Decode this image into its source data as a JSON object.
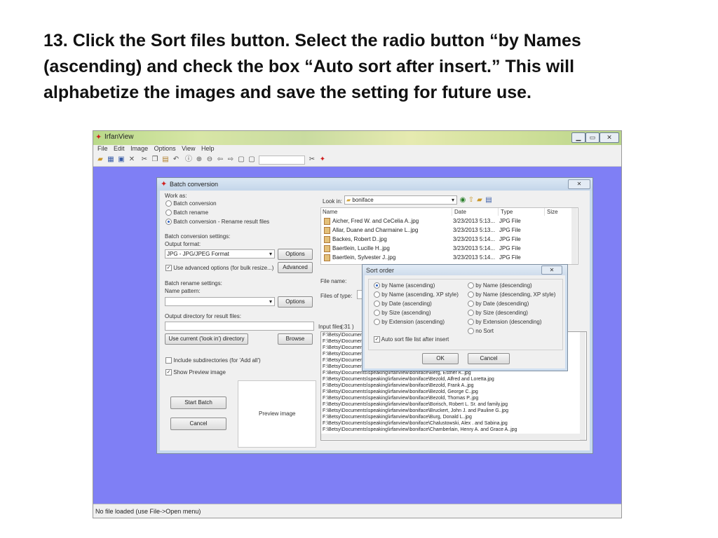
{
  "slide": {
    "title": "13. Click the Sort files button.  Select the radio button “by Names (ascending) and check the box “Auto sort after insert.”  This will alphabetize the images and save the setting for future use."
  },
  "app": {
    "title": "IrfanView",
    "menu": [
      "File",
      "Edit",
      "Image",
      "Options",
      "View",
      "Help"
    ],
    "status": "No file loaded (use File->Open menu)"
  },
  "batch": {
    "title": "Batch conversion",
    "work_as_label": "Work as:",
    "work_as": [
      "Batch conversion",
      "Batch rename",
      "Batch conversion - Rename result files"
    ],
    "conv_settings_label": "Batch conversion settings:",
    "output_format_label": "Output format:",
    "output_format_value": "JPG - JPG/JPEG Format",
    "options_label": "Options",
    "advanced_cb_label": "Use advanced options (for bulk resize...)",
    "advanced_label": "Advanced",
    "rename_settings_label": "Batch rename settings:",
    "name_pattern_label": "Name pattern:",
    "output_dir_label": "Output directory for result files:",
    "use_current_label": "Use current ('look in') directory",
    "browse_label": "Browse",
    "include_subdirs_label": "Include subdirectories (for 'Add all')",
    "show_preview_label": "Show Preview image",
    "start_label": "Start Batch",
    "cancel_label": "Cancel",
    "preview_label": "Preview image",
    "look_in_label": "Look in:",
    "look_in_value": "boniface",
    "columns": [
      "Name",
      "Date",
      "Type",
      "Size"
    ],
    "files": [
      {
        "name": "Aicher, Fred W. and CeCelia A..jpg",
        "date": "3/23/2013 5:13...",
        "type": "JPG File"
      },
      {
        "name": "Allar, Duane and Charmaine L..jpg",
        "date": "3/23/2013 5:13...",
        "type": "JPG File"
      },
      {
        "name": "Backes, Robert D..jpg",
        "date": "3/23/2013 5:14...",
        "type": "JPG File"
      },
      {
        "name": "Baertlein, Lucille H..jpg",
        "date": "3/23/2013 5:14...",
        "type": "JPG File"
      },
      {
        "name": "Baertlein, Sylvester J..jpg",
        "date": "3/23/2013 5:14...",
        "type": "JPG File"
      }
    ],
    "file_name_label": "File name:",
    "files_of_type_label": "Files of type:",
    "input_files_label": "Input files:",
    "input_files_count": "( 31 )",
    "input_paths": [
      "F:\\Betsy\\Documents",
      "F:\\Betsy\\Documents",
      "F:\\Betsy\\Documents",
      "F:\\Betsy\\Documents",
      "F:\\Betsy\\Documents",
      "F:\\Betsy\\Documents\\speaking\\irfanview\\boniface\\Barbien, Todd R..jpg",
      "F:\\Betsy\\Documents\\speaking\\irfanview\\boniface\\Berg, Esther K..jpg",
      "F:\\Betsy\\Documents\\speaking\\irfanview\\boniface\\Bezold, Alfred and Loretta.jpg",
      "F:\\Betsy\\Documents\\speaking\\irfanview\\boniface\\Bezold, Frank A..jpg",
      "F:\\Betsy\\Documents\\speaking\\irfanview\\boniface\\Bezold, George C..jpg",
      "F:\\Betsy\\Documents\\speaking\\irfanview\\boniface\\Bezold, Thomas P..jpg",
      "F:\\Betsy\\Documents\\speaking\\irfanview\\boniface\\Borisch, Robert L. Sr. and family.jpg",
      "F:\\Betsy\\Documents\\speaking\\irfanview\\boniface\\Bruckert, John J. and Pauline G..jpg",
      "F:\\Betsy\\Documents\\speaking\\irfanview\\boniface\\Burg, Donald L..jpg",
      "F:\\Betsy\\Documents\\speaking\\irfanview\\boniface\\Chalustowski, Alex . and Sabina.jpg",
      "F:\\Betsy\\Documents\\speaking\\irfanview\\boniface\\Chamberlain, Henry A. and Grace A..jpg"
    ]
  },
  "sort": {
    "title": "Sort order",
    "left_options": [
      "by Name (ascending)",
      "by Name (ascending, XP style)",
      "by Date (ascending)",
      "by Size (ascending)",
      "by Extension (ascending)"
    ],
    "right_options": [
      "by Name (descending)",
      "by Name (descending, XP style)",
      "by Date (descending)",
      "by Size (descending)",
      "by Extension (descending)",
      "no Sort"
    ],
    "auto_sort_label": "Auto sort file list after insert",
    "ok_label": "OK",
    "cancel_label": "Cancel"
  },
  "colors": {
    "workspace": "#7f7ff5",
    "dialog": "#f0f0f0",
    "accent": "#2a5fbf"
  },
  "icons": [
    "irfanview-app-icon",
    "open-folder-icon",
    "thumbnails-icon",
    "save-icon",
    "delete-icon",
    "cut-icon",
    "copy-icon",
    "paste-icon",
    "undo-icon",
    "info-icon",
    "zoom-in-icon",
    "zoom-out-icon",
    "previous-icon",
    "next-icon",
    "first-page-icon",
    "last-page-icon",
    "tools-icon",
    "irfanview-logo-icon"
  ]
}
